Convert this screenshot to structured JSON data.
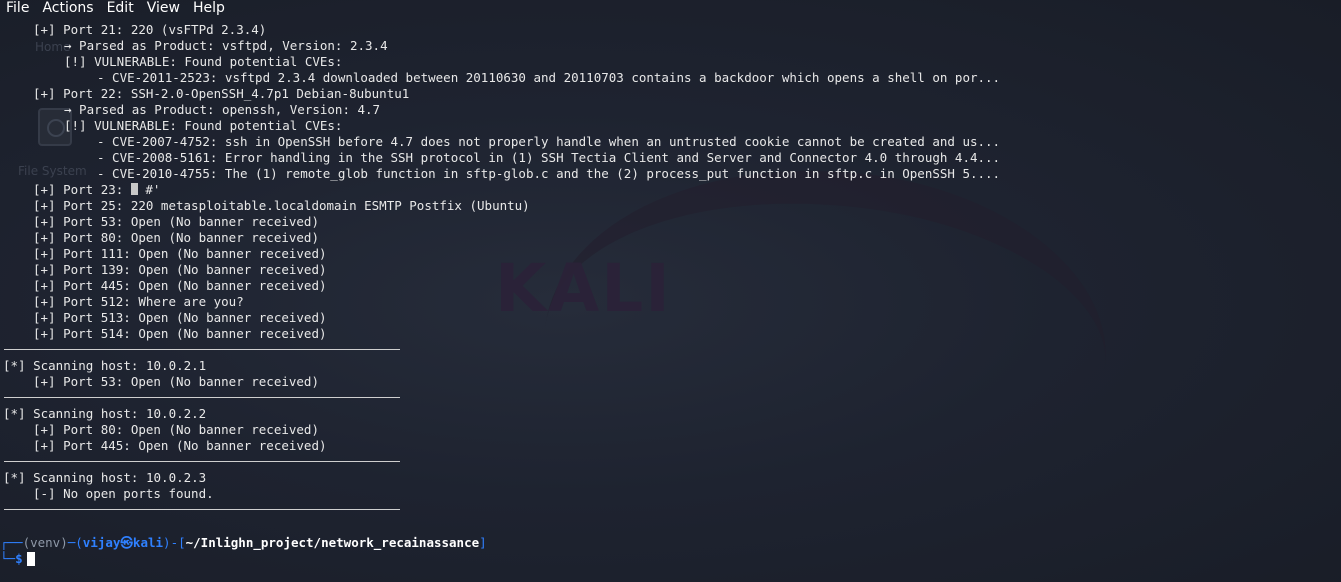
{
  "menu": [
    "File",
    "Actions",
    "Edit",
    "View",
    "Help"
  ],
  "desktop": {
    "home_label": "Home",
    "filesystem_label": "File System",
    "watermark": "KALI"
  },
  "output": [
    {
      "indent": 1,
      "text": "[+] Port 21: 220 (vsFTPd 2.3.4)"
    },
    {
      "indent": 2,
      "text": "→ Parsed as Product: vsftpd, Version: 2.3.4"
    },
    {
      "indent": 2,
      "text": "[!] VULNERABLE: Found potential CVEs:"
    },
    {
      "indent": 3,
      "text": "- CVE-2011-2523: vsftpd 2.3.4 downloaded between 20110630 and 20110703 contains a backdoor which opens a shell on por..."
    },
    {
      "indent": 1,
      "text": "[+] Port 22: SSH-2.0-OpenSSH_4.7p1 Debian-8ubuntu1"
    },
    {
      "indent": 2,
      "text": "→ Parsed as Product: openssh, Version: 4.7"
    },
    {
      "indent": 2,
      "text": "[!] VULNERABLE: Found potential CVEs:"
    },
    {
      "indent": 3,
      "text": "- CVE-2007-4752: ssh in OpenSSH before 4.7 does not properly handle when an untrusted cookie cannot be created and us..."
    },
    {
      "indent": 3,
      "text": "- CVE-2008-5161: Error handling in the SSH protocol in (1) SSH Tectia Client and Server and Connector 4.0 through 4.4..."
    },
    {
      "indent": 3,
      "text": "- CVE-2010-4755: The (1) remote_glob function in sftp-glob.c and the (2) process_put function in sftp.c in OpenSSH 5...."
    },
    {
      "indent": 1,
      "text": "[+] Port 23: ",
      "suffix": " #'"
    },
    {
      "indent": 1,
      "text": "[+] Port 25: 220 metasploitable.localdomain ESMTP Postfix (Ubuntu)"
    },
    {
      "indent": 1,
      "text": "[+] Port 53: Open (No banner received)"
    },
    {
      "indent": 1,
      "text": "[+] Port 80: Open (No banner received)"
    },
    {
      "indent": 1,
      "text": "[+] Port 111: Open (No banner received)"
    },
    {
      "indent": 1,
      "text": "[+] Port 139: Open (No banner received)"
    },
    {
      "indent": 1,
      "text": "[+] Port 445: Open (No banner received)"
    },
    {
      "indent": 1,
      "text": "[+] Port 512: Where are you?"
    },
    {
      "indent": 1,
      "text": "[+] Port 513: Open (No banner received)"
    },
    {
      "indent": 1,
      "text": "[+] Port 514: Open (No banner received)"
    },
    {
      "separator": true
    },
    {
      "indent": 0,
      "text": "[*] Scanning host: 10.0.2.1"
    },
    {
      "indent": 1,
      "text": "[+] Port 53: Open (No banner received)"
    },
    {
      "separator": true
    },
    {
      "indent": 0,
      "text": "[*] Scanning host: 10.0.2.2"
    },
    {
      "indent": 1,
      "text": "[+] Port 80: Open (No banner received)"
    },
    {
      "indent": 1,
      "text": "[+] Port 445: Open (No banner received)"
    },
    {
      "separator": true
    },
    {
      "indent": 0,
      "text": "[*] Scanning host: 10.0.2.3"
    },
    {
      "indent": 1,
      "text": "[-] No open ports found."
    },
    {
      "separator": true
    }
  ],
  "prompt": {
    "corner_top": "┌──",
    "venv": "(venv)",
    "dash": "─",
    "open_paren": "(",
    "user_host": "vijay㉿kali",
    "close_paren": ")",
    "dash2": "-[",
    "path": "~/Inlighn_project/network_recainassance",
    "close_bracket": "]",
    "corner_bottom": "└─",
    "symbol": "$"
  },
  "colors": {
    "background": "#1e2330",
    "text": "#e8e8e8",
    "accent_blue": "#2f80ff"
  }
}
